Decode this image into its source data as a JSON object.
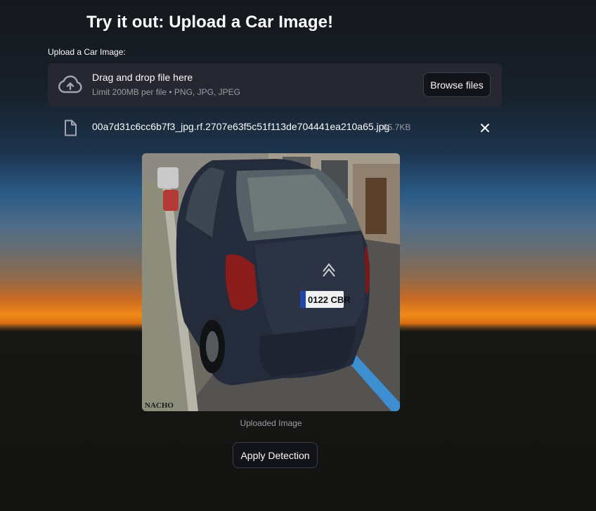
{
  "page": {
    "title": "Try it out: Upload a Car Image!"
  },
  "uploader": {
    "label": "Upload a Car Image:",
    "drag_text": "Drag and drop file here",
    "limit_text": "Limit 200MB per file • PNG, JPG, JPEG",
    "browse_label": "Browse files",
    "icon": "cloud-upload-icon"
  },
  "file": {
    "name": "00a7d31c6cc6b7f3_jpg.rf.2707e63f5c51f113de704441ea210a65.jpg",
    "size": "65.7KB",
    "icon": "file-icon",
    "remove_icon": "close-icon"
  },
  "image": {
    "caption": "Uploaded Image",
    "plate_text": "0122 CBR",
    "watermark": "NACHO"
  },
  "actions": {
    "apply_label": "Apply Detection"
  }
}
